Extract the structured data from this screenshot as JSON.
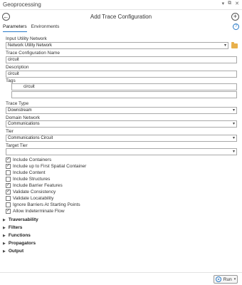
{
  "window": {
    "title": "Geoprocessing",
    "controls": [
      "▾",
      "⧉",
      "✕"
    ]
  },
  "tool": {
    "title": "Add Trace Configuration"
  },
  "tabs": [
    {
      "label": "Parameters",
      "active": true
    },
    {
      "label": "Environments",
      "active": false
    }
  ],
  "form": {
    "input_utility_network": {
      "label": "Input Utility Network",
      "value": "Network Utility Network"
    },
    "trace_configuration_name": {
      "label": "Trace Configuration Name",
      "value": "circuit"
    },
    "description": {
      "label": "Description",
      "value": "circuit"
    },
    "tags": {
      "label": "Tags",
      "values": [
        "circuit",
        ""
      ]
    },
    "trace_type": {
      "label": "Trace Type",
      "value": "Downstream"
    },
    "domain_network": {
      "label": "Domain Network",
      "value": "Communications"
    },
    "tier": {
      "label": "Tier",
      "value": "Communications Circuit"
    },
    "target_tier": {
      "label": "Target Tier",
      "value": ""
    }
  },
  "checkboxes": [
    {
      "label": "Include Containers",
      "checked": true
    },
    {
      "label": "Include up to First Spatial Container",
      "checked": true
    },
    {
      "label": "Include Content",
      "checked": false
    },
    {
      "label": "Include Structures",
      "checked": false
    },
    {
      "label": "Include Barrier Features",
      "checked": true
    },
    {
      "label": "Validate Consistency",
      "checked": true
    },
    {
      "label": "Validate Locatability",
      "checked": false
    },
    {
      "label": "Ignore Barriers At Starting Points",
      "checked": false
    },
    {
      "label": "Allow Indeterminate Flow",
      "checked": true
    }
  ],
  "sections": [
    "Traversability",
    "Filters",
    "Functions",
    "Propagators",
    "Output"
  ],
  "footer": {
    "run_label": "Run"
  },
  "colors": {
    "accent": "#2a7ac7",
    "folder": "#e8b04b"
  }
}
